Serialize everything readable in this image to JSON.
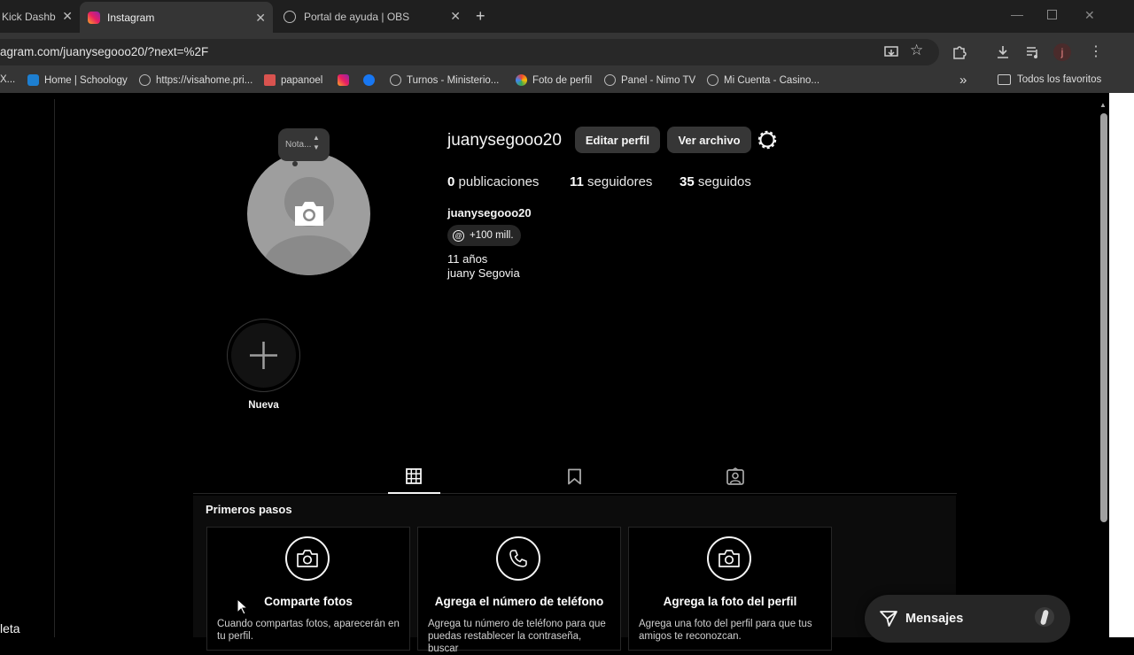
{
  "browser": {
    "tabs": [
      {
        "label": "Kick Dashb"
      },
      {
        "label": "Instagram"
      },
      {
        "label": "Portal de ayuda | OBS"
      }
    ],
    "new_tab": "+",
    "url": "agram.com/juanysegooo20/?next=%2F",
    "profile_initial": "j",
    "bookmarks": [
      {
        "label": "X..."
      },
      {
        "label": "Home | Schoology"
      },
      {
        "label": "https://visahome.pri..."
      },
      {
        "label": "papanoel"
      },
      {
        "label": "Turnos - Ministerio..."
      },
      {
        "label": "Foto de perfil"
      },
      {
        "label": "Panel - Nimo TV"
      },
      {
        "label": "Mi Cuenta - Casino..."
      }
    ],
    "overflow": "»",
    "all_bookmarks": "Todos los favoritos"
  },
  "profile": {
    "note_bubble": "Nota...",
    "username": "juanysegooo20",
    "edit_button": "Editar perfil",
    "archive_button": "Ver archivo",
    "stats": [
      {
        "count": "0",
        "label": "publicaciones"
      },
      {
        "count": "11",
        "label": "seguidores"
      },
      {
        "count": "35",
        "label": "seguidos"
      }
    ],
    "display_name": "juanysegooo20",
    "threads_badge": "+100 mill.",
    "bio_line1": "11 años",
    "bio_line2": "juany Segovia",
    "new_highlight": "Nueva"
  },
  "getting_started": {
    "title": "Primeros pasos",
    "cards": [
      {
        "title": "Comparte fotos",
        "desc": "Cuando compartas fotos, aparecerán en tu perfil."
      },
      {
        "title": "Agrega el número de teléfono",
        "desc": "Agrega tu número de teléfono para que puedas restablecer la contraseña, buscar"
      },
      {
        "title": "Agrega la foto del perfil",
        "desc": "Agrega una foto del perfil para que tus amigos te reconozcan."
      }
    ]
  },
  "messages_label": "Mensajes",
  "left_edge_text": "leta"
}
